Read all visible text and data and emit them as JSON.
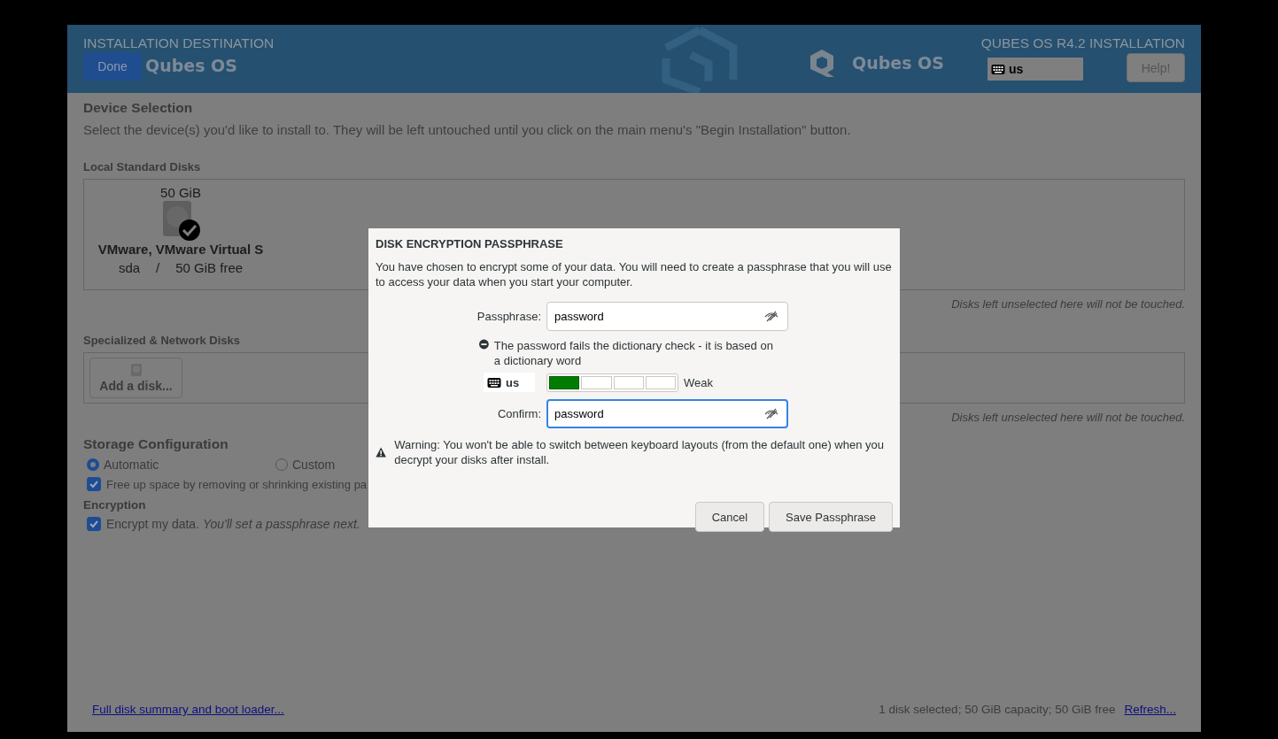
{
  "header": {
    "title": "INSTALLATION DESTINATION",
    "done_button": "Done",
    "brand_left": "Qubes OS",
    "brand_center": "Qubes OS",
    "product": "QUBES OS R4.2 INSTALLATION",
    "keyboard": "us",
    "help_button": "Help!"
  },
  "device_selection": {
    "heading": "Device Selection",
    "description": "Select the device(s) you'd like to install to.  They will be left untouched until you click on the main menu's \"Begin Installation\" button."
  },
  "local_disks": {
    "heading": "Local Standard Disks",
    "disks": [
      {
        "size": "50 GiB",
        "name": "VMware, VMware Virtual S",
        "device": "sda",
        "separator": "/",
        "free": "50 GiB free",
        "selected": true
      }
    ],
    "note": "Disks left unselected here will not be touched."
  },
  "network_disks": {
    "heading": "Specialized & Network Disks",
    "add_button": "Add a disk...",
    "note": "Disks left unselected here will not be touched."
  },
  "storage": {
    "heading": "Storage Configuration",
    "options": [
      {
        "label": "Automatic",
        "selected": true
      },
      {
        "label": "Custom",
        "selected": false
      }
    ],
    "free_up": {
      "label": "Free up space by removing or shrinking existing pa",
      "checked": true
    }
  },
  "encryption": {
    "heading": "Encryption",
    "encrypt": {
      "label": "Encrypt my data.  *You'll set a passphrase next.*",
      "checked": true
    }
  },
  "footer": {
    "summary_link": "Full disk summary and boot loader...",
    "status": "1 disk selected; 50 GiB capacity; 50 GiB free",
    "refresh_link": "Refresh..."
  },
  "dialog": {
    "title": "DISK ENCRYPTION PASSPHRASE",
    "message": "You have chosen to encrypt some of your data. You will need to create a passphrase that you will use to access your data when you start your computer.",
    "passphrase": {
      "label": "Passphrase:",
      "value": "password",
      "focused": false
    },
    "check_message": "The password fails the dictionary check - it is based on a dictionary word",
    "keyboard": "us",
    "strength": {
      "level": 0.25,
      "label": "Weak"
    },
    "confirm": {
      "label": "Confirm:",
      "value": "password",
      "focused": true
    },
    "warning": "Warning: You won't be able to switch between keyboard layouts (from the default one) when you decrypt your disks after install.",
    "buttons": [
      "Cancel",
      "Save Passphrase"
    ]
  }
}
